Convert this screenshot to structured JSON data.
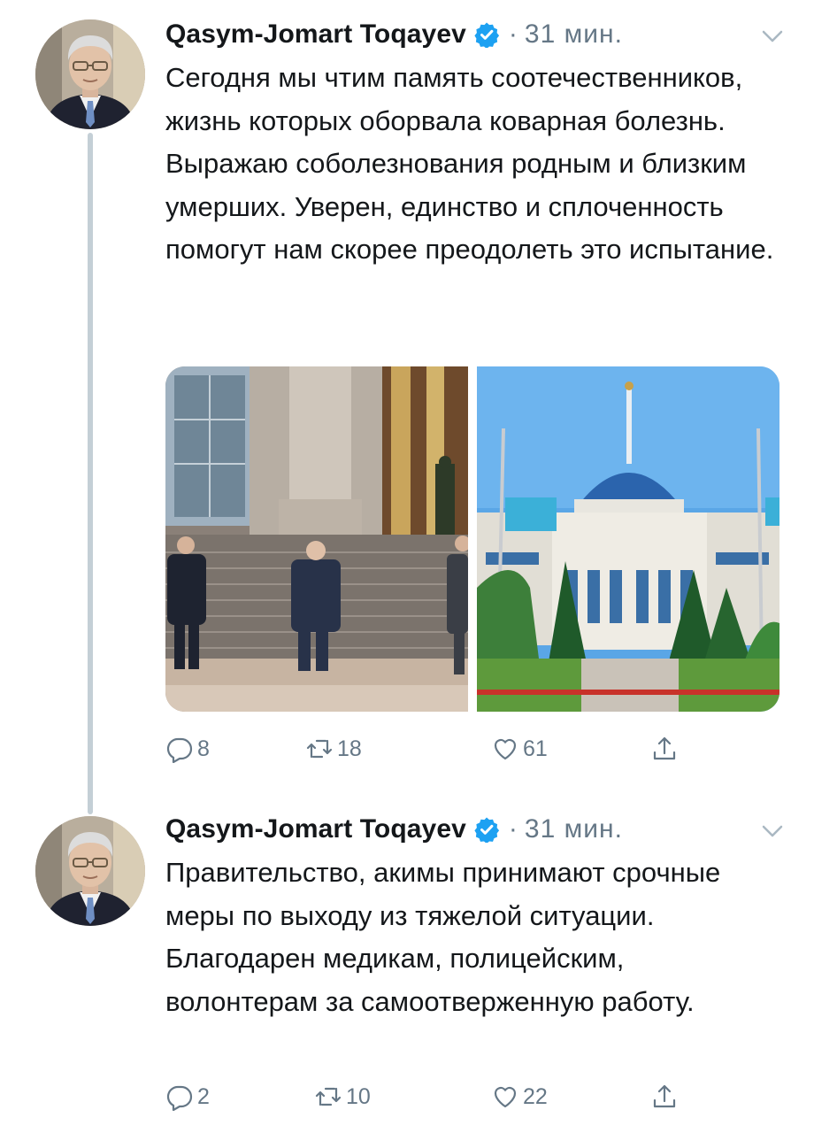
{
  "tweets": [
    {
      "author": "Qasym-Jomart Toqayev",
      "separator": "·",
      "time": "31 мин.",
      "text": "Сегодня мы чтим память соотечественников, жизнь которых оборвала коварная болезнь. Выражаю соболезнования родным и близким умерших. Уверен, единство и сплоченность помогут нам скорее преодолеть это испытание.",
      "replies": "8",
      "retweets": "18",
      "likes": "61",
      "icons": {
        "verified": "verified-badge-icon",
        "menu": "chevron-down-icon",
        "reply": "reply-icon",
        "retweet": "retweet-icon",
        "like": "heart-icon",
        "share": "share-icon"
      }
    },
    {
      "author": "Qasym-Jomart Toqayev",
      "separator": "·",
      "time": "31 мин.",
      "text": "Правительство, акимы принимают срочные меры по выходу из тяжелой ситуации. Благодарен медикам, полицейским, волонтерам за самоотверженную работу.",
      "replies": "2",
      "retweets": "10",
      "likes": "22"
    }
  ],
  "colors": {
    "text": "#14171a",
    "secondary": "#657786",
    "verified": "#1da1f2",
    "thread_line": "#c4cfd6"
  }
}
